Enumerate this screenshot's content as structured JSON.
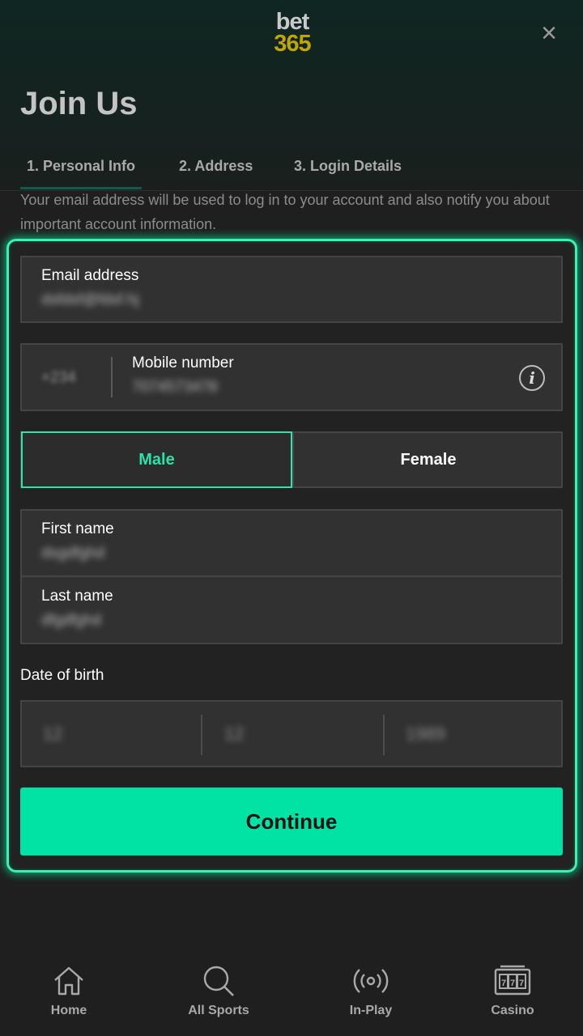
{
  "header": {
    "logo_line1": "bet",
    "logo_line2": "365",
    "close_symbol": "×",
    "title": "Join Us"
  },
  "tabs": [
    {
      "label": "1.  Personal Info",
      "active": true
    },
    {
      "label": "2.  Address",
      "active": false
    },
    {
      "label": "3.  Login Details",
      "active": false
    }
  ],
  "intro_text": "Your email address will be used to log in to your account and also notify you about important account information.",
  "form": {
    "email": {
      "label": "Email address",
      "value": "dsfdsf@fdsf.hj"
    },
    "mobile": {
      "code": "+234",
      "label": "Mobile number",
      "value": "7074573478",
      "info_symbol": "i"
    },
    "gender": {
      "male": "Male",
      "female": "Female",
      "selected": "Male"
    },
    "first_name": {
      "label": "First name",
      "value": "dsgdfghd"
    },
    "last_name": {
      "label": "Last name",
      "value": "dfgdfghd"
    },
    "dob": {
      "label": "Date of birth",
      "day": "12",
      "month": "12",
      "year": "1989"
    },
    "continue_label": "Continue"
  },
  "bottom_nav": [
    {
      "label": "Home",
      "icon": "home-icon"
    },
    {
      "label": "All Sports",
      "icon": "search-icon"
    },
    {
      "label": "In-Play",
      "icon": "broadcast-icon"
    },
    {
      "label": "Casino",
      "icon": "slot-machine-icon"
    }
  ],
  "colors": {
    "accent": "#00e3a5",
    "selected_text": "#27e3a9",
    "logo_yellow": "#bfa600",
    "background": "#1f1f1f",
    "field_bg": "#313131"
  }
}
